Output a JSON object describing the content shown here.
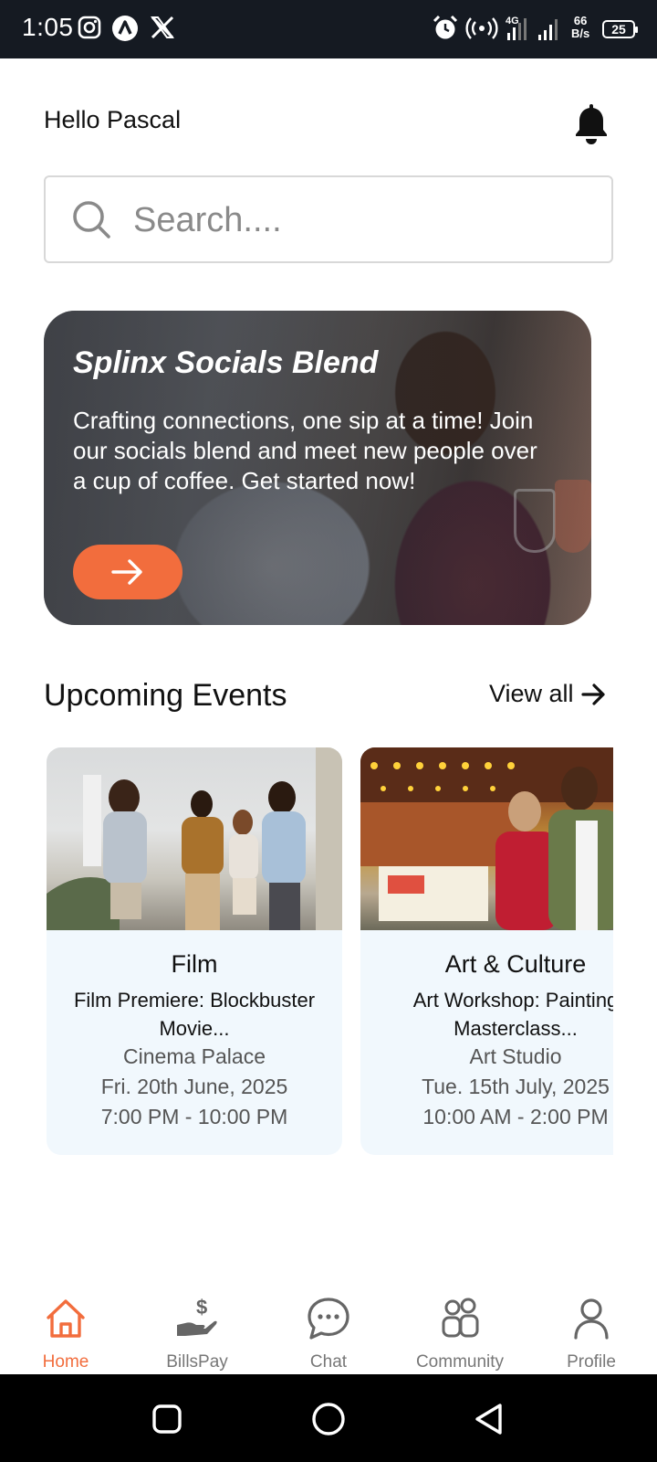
{
  "status_bar": {
    "time": "1:05",
    "speed_value": "66",
    "speed_unit": "B/s",
    "network": "4G",
    "battery": "25",
    "icons": [
      "instagram-icon",
      "app-a-icon",
      "x-icon",
      "alarm-icon",
      "hotspot-icon",
      "signal-icon"
    ]
  },
  "header": {
    "greeting": "Hello Pascal",
    "icon": "bell-icon"
  },
  "search": {
    "placeholder": "Search....",
    "value": ""
  },
  "hero": {
    "title": "Splinx Socials Blend",
    "text": "Crafting connections, one sip at a time! Join our socials blend and meet new people over a cup of coffee. Get started now!",
    "button_icon": "arrow-right-icon",
    "button_color": "#f26d3d"
  },
  "events_section": {
    "title": "Upcoming Events",
    "view_all": "View all"
  },
  "events": [
    {
      "category": "Film",
      "title": "Film Premiere: Blockbuster Movie...",
      "venue": "Cinema Palace",
      "date": "Fri. 20th June, 2025",
      "time": "7:00 PM - 10:00 PM"
    },
    {
      "category": "Art & Culture",
      "title": "Art Workshop: Painting Masterclass...",
      "venue": "Art Studio",
      "date": "Tue. 15th July, 2025",
      "time": "10:00 AM - 2:00 PM"
    }
  ],
  "bottom_nav": [
    {
      "label": "Home",
      "icon": "home-icon",
      "active": true
    },
    {
      "label": "BillsPay",
      "icon": "billspay-icon",
      "active": false
    },
    {
      "label": "Chat",
      "icon": "chat-icon",
      "active": false
    },
    {
      "label": "Community",
      "icon": "community-icon",
      "active": false
    },
    {
      "label": "Profile",
      "icon": "profile-icon",
      "active": false
    }
  ],
  "colors": {
    "accent": "#f26d3d",
    "card_background": "#f1f8fd",
    "status_bar": "#151a22"
  }
}
